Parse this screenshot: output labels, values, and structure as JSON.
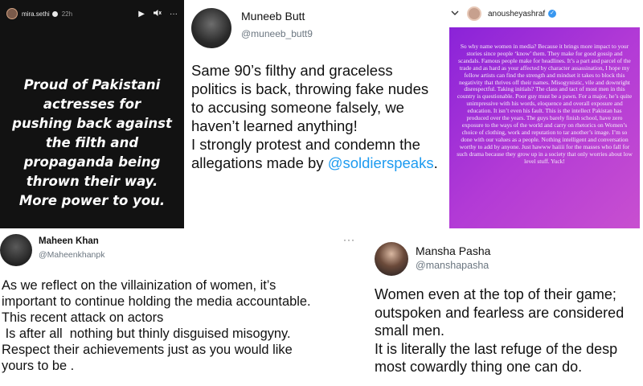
{
  "story": {
    "username": "mira.sethi",
    "time": "22h",
    "play_icon": "play-icon",
    "mute_icon": "mute-icon",
    "more_icon": "more-icon",
    "text": "Proud of Pakistani actresses for pushing back against the filth and propaganda being thrown their way. More power to you."
  },
  "muneeb": {
    "name": "Muneeb Butt",
    "handle": "@muneeb_butt9",
    "text": "Same 90’s filthy and graceless politics is back, throwing fake nudes to accusing someone falsely, we haven’t learned anything!\nI strongly protest and condemn the allegations made by ",
    "mention": "@soldierspeaks",
    "suffix": "."
  },
  "anoushey": {
    "username": "anousheyashraf",
    "text": "So why name women in media? Because it brings more impact to your stories since people ‘know’ them. They make for good gossip and scandals. Famous people make for headlines. It’s a part and parcel of the trade and as hard as your affected by character assassination, I hope my fellow artists can find the strength and mindset it takes to block this negativity that thrives off their names. Misogynistic, vile and downright disrespectful. Taking initials? The class and tact of most men in this country is questionable. Poor guy must be a pawn. For a major, he’s quite unimpressive with his words, eloquence and overall exposure and education. It isn’t even his fault. This is the intellect Pakistan has produced over the years. The guys barely finish school, have zero exposure to the ways of the world and carry on rhetorics on Women’s choice of clothing, work and reputation to tar another’s image. I’m so done with our values as a people. Nothing intelligent and conversation worthy to add by anyone. Just hawww haiiii for the masses who fall for such drama because they grow up in a society that only worries about low level stuff. Yuck!"
  },
  "maheen": {
    "name": "Maheen Khan",
    "handle": "@Maheenkhanpk",
    "more": "···",
    "text": "As we reflect on the villainization of women, it’s\nimportant to continue holding the media accountable.\nThis recent attack on actors\n Is after all  nothing but thinly disguised misogyny.\nRespect their achievements just as you would like\nyours to be ."
  },
  "mansha": {
    "name": "Mansha Pasha",
    "handle": "@manshapasha",
    "line1": "Women even at the top of their game;",
    "line2": "outspoken and fearless are considered",
    "line3": "small men.",
    "line4": "It is literally the last refuge of the desp",
    "line5": "most cowardly thing one can do."
  }
}
